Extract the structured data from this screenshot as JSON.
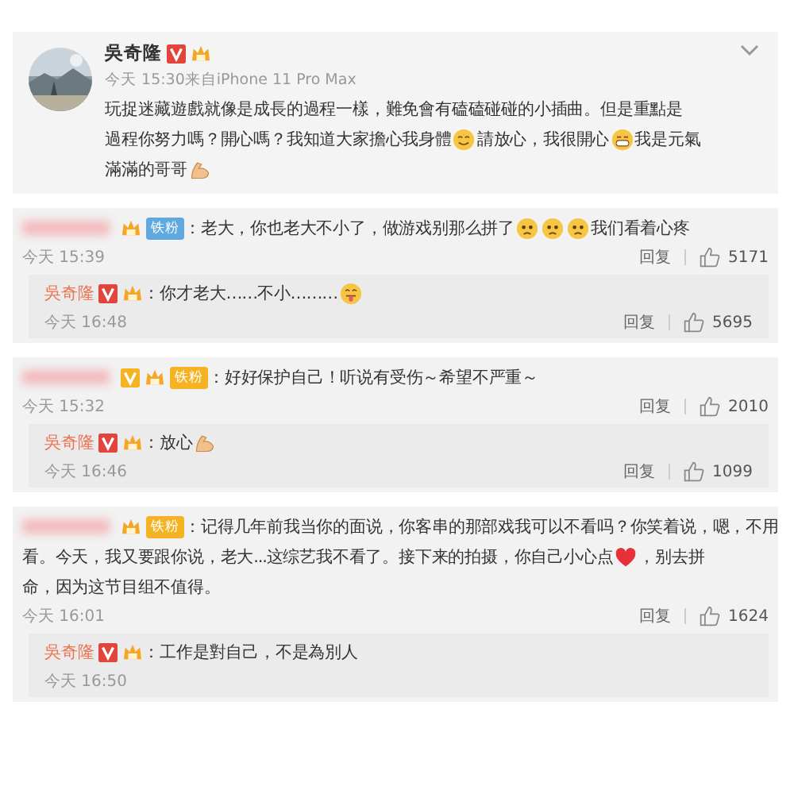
{
  "post": {
    "author": "吳奇隆",
    "time": "今天 15:30来自iPhone 11 Pro Max",
    "lines": [
      [
        {
          "kind": "text",
          "text": "玩捉迷藏遊戲就像是成長的過程一樣，難免會有磕磕碰碰的小插曲。但是重點是"
        }
      ],
      [
        {
          "kind": "text",
          "text": "過程你努力嗎？開心嗎？我知道大家擔心我身體"
        },
        {
          "kind": "smile"
        },
        {
          "kind": "text",
          "text": "請放心，我很開心"
        },
        {
          "kind": "grin"
        },
        {
          "kind": "text",
          "text": "我是元氣"
        }
      ],
      [
        {
          "kind": "text",
          "text": "滿滿的哥哥"
        },
        {
          "kind": "flex"
        }
      ]
    ]
  },
  "comments": [
    {
      "verified": false,
      "badge": {
        "text": "铁粉",
        "color": "#5fa8e0"
      },
      "lines": [
        [
          {
            "kind": "text",
            "text": "：老大，你也老大不小了，做游戏别那么拼了"
          },
          {
            "kind": "worry"
          },
          {
            "kind": "worry"
          },
          {
            "kind": "worry"
          },
          {
            "kind": "text",
            "text": "我们看着心疼"
          }
        ]
      ],
      "time": "今天 15:39",
      "reply_label": "回复",
      "likes": "5171",
      "reply": {
        "author": "吳奇隆",
        "lines": [
          [
            {
              "kind": "text",
              "text": "：你才老大……不小………"
            },
            {
              "kind": "tongue"
            }
          ]
        ],
        "time": "今天 16:48",
        "reply_label": "回复",
        "likes": "5695"
      }
    },
    {
      "verified": true,
      "badge": {
        "text": "铁粉",
        "color": "#f5b324"
      },
      "lines": [
        [
          {
            "kind": "text",
            "text": "：好好保护自己！听说有受伤～希望不严重～"
          }
        ]
      ],
      "time": "今天 15:32",
      "reply_label": "回复",
      "likes": "2010",
      "reply": {
        "author": "吳奇隆",
        "lines": [
          [
            {
              "kind": "text",
              "text": "：放心"
            },
            {
              "kind": "flex"
            }
          ]
        ],
        "time": "今天 16:46",
        "reply_label": "回复",
        "likes": "1099"
      }
    },
    {
      "verified": false,
      "badge": {
        "text": "铁粉",
        "color": "#f5b324"
      },
      "lines": [
        [
          {
            "kind": "text",
            "text": "：记得几年前我当你的面说，你客串的那部戏我可以不看吗？你笑着说，嗯，不用"
          }
        ],
        [
          {
            "kind": "text",
            "text": "看。今天，我又要跟你说，老大...这综艺我不看了。接下来的拍摄，你自己小心点"
          },
          {
            "kind": "heart"
          },
          {
            "kind": "text",
            "text": "，别去拼"
          }
        ],
        [
          {
            "kind": "text",
            "text": "命，因为这节目组不值得。"
          }
        ]
      ],
      "time": "今天 16:01",
      "reply_label": "回复",
      "likes": "1624",
      "reply": {
        "author": "吳奇隆",
        "lines": [
          [
            {
              "kind": "text",
              "text": "：工作是對自己，不是為別人"
            }
          ]
        ],
        "time": "今天 16:50"
      }
    }
  ]
}
